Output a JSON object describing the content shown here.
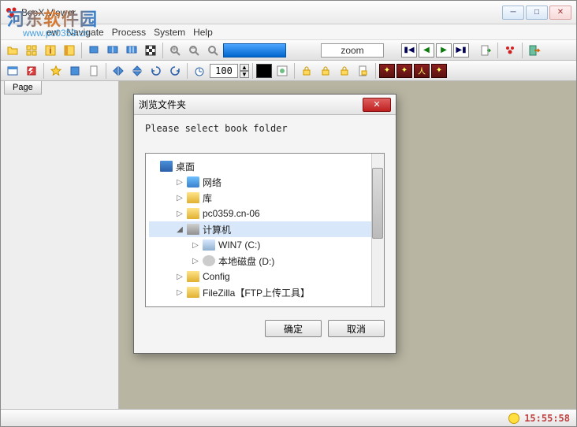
{
  "app": {
    "title": "BooX Viewer"
  },
  "watermark": {
    "main": "河东软件园",
    "sub": "www.pc0359.cn"
  },
  "menu": {
    "view": "ew",
    "navigate": "Navigate",
    "process": "Process",
    "system": "System",
    "help": "Help"
  },
  "toolbar1": {
    "zoom_label": "zoom"
  },
  "toolbar2": {
    "percent": "100"
  },
  "sidebar": {
    "tab": "Page"
  },
  "status": {
    "time": "15:55:58"
  },
  "dialog": {
    "title": "浏览文件夹",
    "prompt": "Please select book folder",
    "ok": "确定",
    "cancel": "取消",
    "tree": {
      "desktop": "桌面",
      "network": "网络",
      "library": "库",
      "pc": "pc0359.cn-06",
      "computer": "计算机",
      "win7": "WIN7 (C:)",
      "localdisk": "本地磁盘 (D:)",
      "config": "Config",
      "filezilla": "FileZilla【FTP上传工具】"
    }
  }
}
